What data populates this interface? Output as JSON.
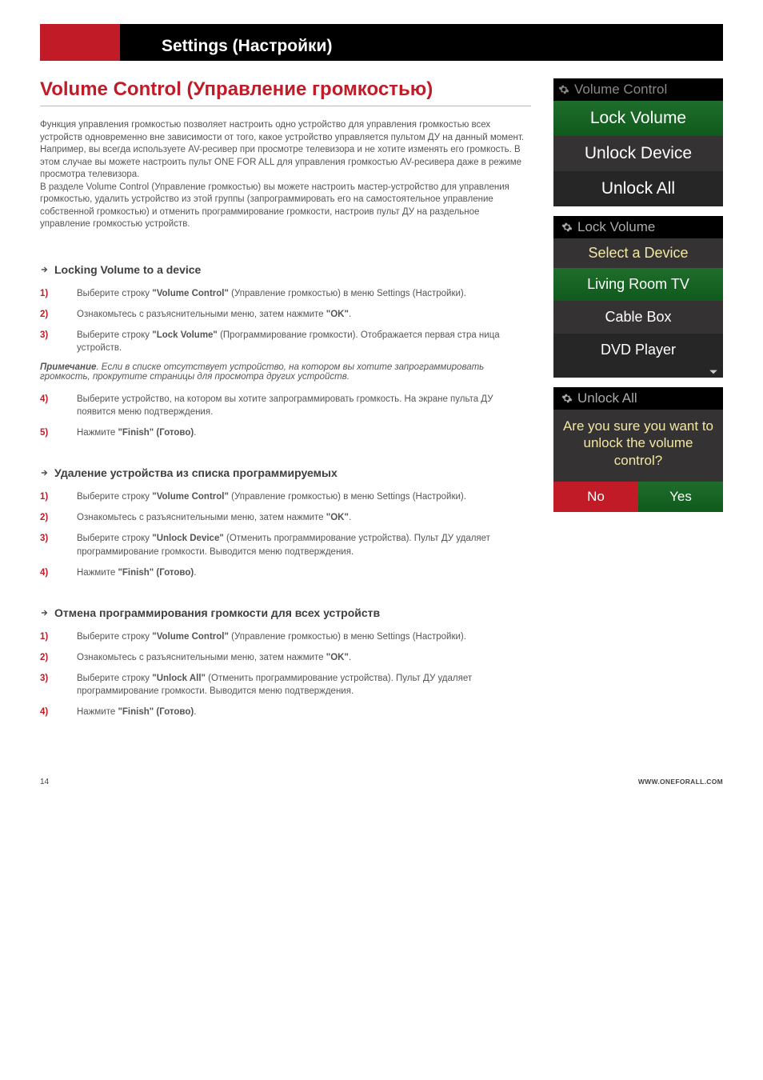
{
  "header": {
    "title": "Settings (Настройки)"
  },
  "main": {
    "title": "Volume Control (Управление громкостью)",
    "intro_p1": "Функция управления громкостью позволяет настроить одно устройство для управления громкостью всех устройств одновременно вне зависимости от того, какое устройство управляется пультом ДУ на данный момент.  Например, вы всегда используете AV-ресивер при просмотре телевизора и не хотите изменять его громкость. В этом случае вы можете настроить пульт ONE FOR ALL для управления громкостью AV-ресивера даже в режиме просмотра телевизора.",
    "intro_p2": "В разделе Volume Control (Управление громкостью) вы можете настроить мастер-устройство для управления громкостью, удалить устройство из этой группы (запрограммировать его на самостоятельное управление собственной громкостью) и отменить программирование громкости, настроив пульт ДУ на раздельное управление громкостью устройств."
  },
  "sections": [
    {
      "heading": "Locking Volume to a device",
      "steps": [
        {
          "n": "1)",
          "pre": "Выберите строку ",
          "bold": "\"Volume Control\"",
          "post": " (Управление громкостью) в меню Settings (Настройки)."
        },
        {
          "n": "2)",
          "pre": "Ознакомьтесь с разъяснительными меню, затем нажмите ",
          "bold": "\"OK\"",
          "post": "."
        },
        {
          "n": "3)",
          "pre": "Выберите строку ",
          "bold": "\"Lock Volume\"",
          "post": " (Программирование громкости). Отображается первая стра ница устройств."
        }
      ],
      "note_label": "Примечание",
      "note_text": ". Если в списке отсутствует устройство, на котором вы хотите запрограммировать громкость, прокрутите страницы для просмотра других устройств.",
      "steps_after": [
        {
          "n": "4)",
          "pre": "Выберите устройство, на котором вы хотите запрограммировать громкость. На экране пульта ДУ появится меню подтверждения.",
          "bold": "",
          "post": ""
        },
        {
          "n": "5)",
          "pre": "Нажмите ",
          "bold": "\"Finish\" (Готово)",
          "post": "."
        }
      ]
    },
    {
      "heading": "Удаление устройства из списка программируемых",
      "steps": [
        {
          "n": "1)",
          "pre": "Выберите строку ",
          "bold": "\"Volume Control\"",
          "post": " (Управление громкостью) в меню Settings (Настройки)."
        },
        {
          "n": "2)",
          "pre": "Ознакомьтесь с разъяснительными меню, затем нажмите ",
          "bold": "\"OK\"",
          "post": "."
        },
        {
          "n": "3)",
          "pre": "Выберите строку ",
          "bold": "\"Unlock Device\"",
          "post": " (Отменить программирование устройства). Пульт ДУ удаляет программирование громкости. Выводится меню подтверждения."
        },
        {
          "n": "4)",
          "pre": "Нажмите ",
          "bold": "\"Finish\" (Готово)",
          "post": "."
        }
      ]
    },
    {
      "heading": "Отмена программирования громкости для всех устройств",
      "steps": [
        {
          "n": "1)",
          "pre": "Выберите строку ",
          "bold": "\"Volume Control\"",
          "post": " (Управление громкостью) в меню Settings (Настройки)."
        },
        {
          "n": "2)",
          "pre": "Ознакомьтесь с разъяснительными меню, затем нажмите ",
          "bold": "\"OK\"",
          "post": "."
        },
        {
          "n": "3)",
          "pre": "Выберите строку ",
          "bold": "\"Unlock All\"",
          "post": " (Отменить программирование устройства). Пульт ДУ удаляет программирование громкости. Выводится меню подтверждения."
        },
        {
          "n": "4)",
          "pre": "Нажмите ",
          "bold": "\"Finish\" (Готово)",
          "post": "."
        }
      ]
    }
  ],
  "screens": {
    "vc": {
      "header": "Volume Control",
      "items": [
        "Lock Volume",
        "Unlock Device",
        "Unlock All"
      ]
    },
    "lock": {
      "header": "Lock Volume",
      "prompt": "Select a Device",
      "items": [
        "Living Room TV",
        "Cable Box",
        "DVD Player"
      ]
    },
    "unlock": {
      "header": "Unlock All",
      "question": "Are you sure you want to unlock the volume control?",
      "no": "No",
      "yes": "Yes"
    }
  },
  "footer": {
    "page": "14",
    "url": "WWW.ONEFORALL.COM"
  }
}
